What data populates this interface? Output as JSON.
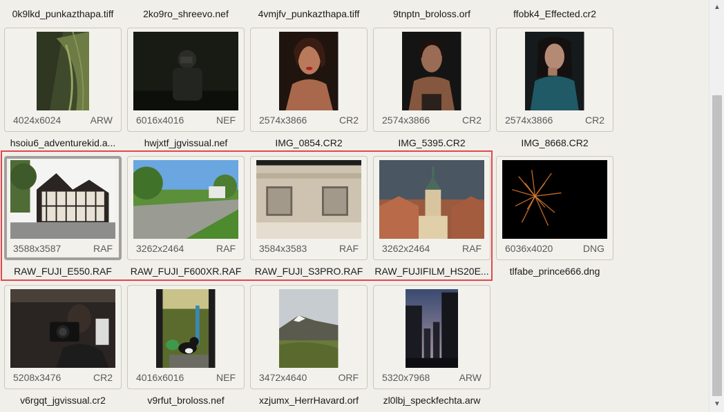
{
  "row_top": [
    "0k9lkd_punkazthapa.tiff",
    "2ko9ro_shreevo.nef",
    "4vmjfv_punkazthapa.tiff",
    "9tnptn_broloss.orf",
    "ffobk4_Effected.cr2"
  ],
  "rows": [
    [
      {
        "name": "hsoiu6_adventurekid.a...",
        "dims": "4024x6024",
        "format": "ARW",
        "image": "grass-closeup"
      },
      {
        "name": "hwjxtf_jgvissual.nef",
        "dims": "6016x4016",
        "format": "NEF",
        "image": "dark-photographer"
      },
      {
        "name": "IMG_0854.CR2",
        "dims": "2574x3866",
        "format": "CR2",
        "image": "portrait-woman"
      },
      {
        "name": "IMG_5395.CR2",
        "dims": "2574x3866",
        "format": "CR2",
        "image": "portrait-woman-dark"
      },
      {
        "name": "IMG_8668.CR2",
        "dims": "2574x3866",
        "format": "CR2",
        "image": "portrait-woman-teal"
      }
    ],
    [
      {
        "name": "RAW_FUJI_E550.RAF",
        "dims": "3588x3587",
        "format": "RAF",
        "image": "tudor-house",
        "focused": true
      },
      {
        "name": "RAW_FUJI_F600XR.RAF",
        "dims": "3262x2464",
        "format": "RAF",
        "image": "park-path"
      },
      {
        "name": "RAW_FUJI_S3PRO.RAF",
        "dims": "3584x3583",
        "format": "RAF",
        "image": "building-facade"
      },
      {
        "name": "RAW_FUJIFILM_HS20E...",
        "dims": "3262x2464",
        "format": "RAF",
        "image": "church-tower"
      },
      {
        "name": "tlfabe_prince666.dng",
        "dims": "6036x4020",
        "format": "DNG",
        "image": "fireworks"
      }
    ],
    [
      {
        "name": "v6rgqt_jgvissual.cr2",
        "dims": "5208x3476",
        "format": "CR2",
        "image": "mirror-selfie"
      },
      {
        "name": "v9rfut_broloss.nef",
        "dims": "4016x6016",
        "format": "NEF",
        "image": "cat-garden"
      },
      {
        "name": "xzjumx_HerrHavard.orf",
        "dims": "3472x4640",
        "format": "ORF",
        "image": "mountain"
      },
      {
        "name": "zl0lbj_speckfechta.arw",
        "dims": "5320x7968",
        "format": "ARW",
        "image": "dusk-buildings"
      }
    ]
  ],
  "colors": {
    "selection": "#e0474c",
    "focus_border": "#a1a09d",
    "card_bg": "#f3f1ec"
  },
  "scrollbar": {
    "up_icon": "chevron-up-icon",
    "down_icon": "chevron-down-icon",
    "up_glyph": "▲",
    "down_glyph": "▼"
  }
}
